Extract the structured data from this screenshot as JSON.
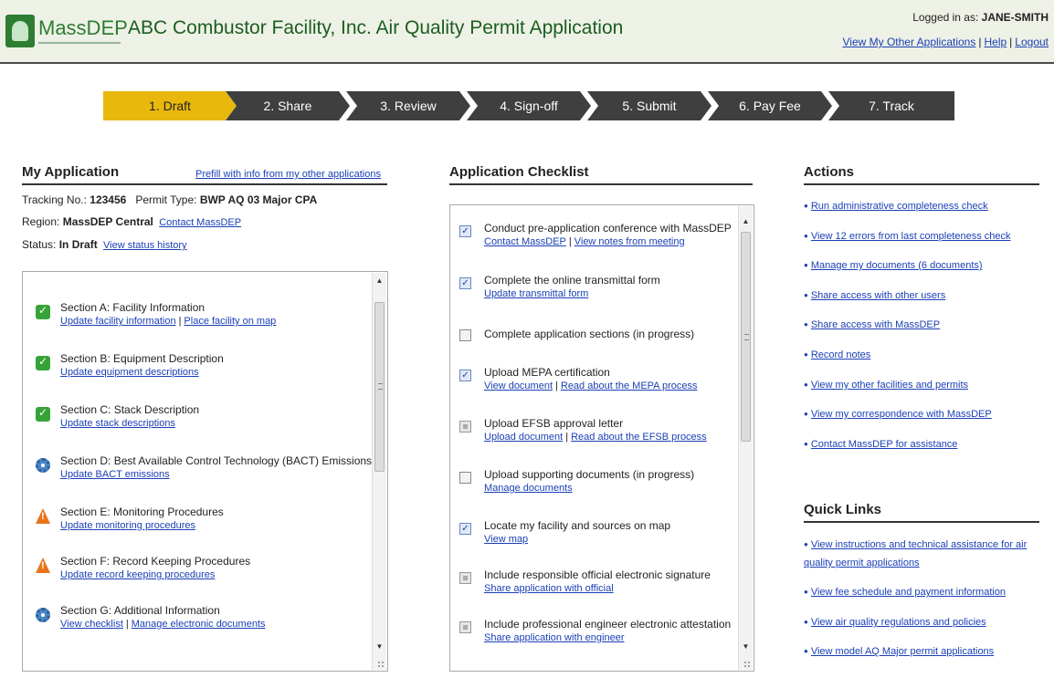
{
  "header": {
    "logo_text": "MassDEP",
    "title": "ABC Combustor Facility, Inc. Air Quality Permit Application",
    "logged_in_label": "Logged in as:",
    "user": "JANE-SMITH",
    "links": [
      "View My Other Applications",
      "Help",
      "Logout"
    ]
  },
  "steps": [
    "1. Draft",
    "2. Share",
    "3. Review",
    "4. Sign-off",
    "5. Submit",
    "6. Pay Fee",
    "7. Track"
  ],
  "active_step": 0,
  "my_application": {
    "heading": "My Application",
    "prefill_link": "Prefill with info from my other applications",
    "tracking_label": "Tracking No.:",
    "tracking_no": "123456",
    "permit_type_label": "Permit Type:",
    "permit_type": "BWP AQ 03 Major CPA",
    "region_label": "Region:",
    "region": "MassDEP Central",
    "contact_link": "Contact MassDEP",
    "status_label": "Status:",
    "status": "In Draft",
    "status_history_link": "View status history",
    "sections": [
      {
        "icon": "check-icon",
        "title": "Section A: Facility Information",
        "links": [
          "Update facility information",
          "Place facility on map"
        ]
      },
      {
        "icon": "check-icon",
        "title": "Section B: Equipment Description",
        "links": [
          "Update equipment descriptions"
        ]
      },
      {
        "icon": "check-icon",
        "title": "Section C: Stack Description",
        "links": [
          "Update stack descriptions"
        ]
      },
      {
        "icon": "gear-icon",
        "title": "Section D: Best Available Control Technology (BACT) Emissions",
        "links": [
          "Update BACT emissions"
        ]
      },
      {
        "icon": "warning-icon",
        "title": "Section E: Monitoring Procedures",
        "links": [
          "Update monitoring procedures"
        ]
      },
      {
        "icon": "warning-icon",
        "title": "Section F: Record Keeping Procedures",
        "links": [
          "Update record keeping procedures"
        ]
      },
      {
        "icon": "gear-icon",
        "title": "Section G: Additional Information",
        "links": [
          "View checklist",
          "Manage electronic documents"
        ]
      }
    ]
  },
  "checklist": {
    "heading": "Application Checklist",
    "items": [
      {
        "state": "checked",
        "title": "Conduct pre-application conference with MassDEP",
        "links": [
          "Contact MassDEP",
          "View notes from meeting"
        ]
      },
      {
        "state": "checked",
        "title": "Complete the online transmittal form",
        "links": [
          "Update transmittal form"
        ]
      },
      {
        "state": "unchecked",
        "title": "Complete application sections (in progress)",
        "links": []
      },
      {
        "state": "checked",
        "title": "Upload MEPA certification",
        "links": [
          "View document",
          "Read about the MEPA process"
        ]
      },
      {
        "state": "partial",
        "title": "Upload EFSB approval letter",
        "links": [
          "Upload document",
          "Read about the EFSB process"
        ]
      },
      {
        "state": "unchecked",
        "title": "Upload supporting documents (in progress)",
        "links": [
          "Manage documents"
        ]
      },
      {
        "state": "checked",
        "title": "Locate my facility and sources on map",
        "links": [
          "View map"
        ]
      },
      {
        "state": "partial",
        "title": "Include responsible official electronic signature",
        "links": [
          "Share application with official"
        ]
      },
      {
        "state": "partial",
        "title": "Include professional engineer electronic attestation",
        "links": [
          "Share application with engineer"
        ]
      }
    ]
  },
  "actions": {
    "heading": "Actions",
    "items": [
      "Run administrative completeness check",
      "View 12 errors from last completeness check",
      "Manage my documents (6 documents)",
      "Share access with other users",
      "Share access with MassDEP",
      "Record notes",
      "View my other facilities and permits",
      "View my correspondence with MassDEP",
      "Contact MassDEP for assistance"
    ]
  },
  "quick_links": {
    "heading": "Quick Links",
    "items": [
      "View instructions and technical assistance for air quality permit applications",
      "View fee schedule and payment information",
      "View air quality regulations and policies",
      "View model AQ Major permit applications"
    ]
  },
  "colors": {
    "active_step": "#e8b80d",
    "step": "#3f3f3f",
    "link": "#1a3fb5",
    "header_bg": "#eef1e6"
  }
}
